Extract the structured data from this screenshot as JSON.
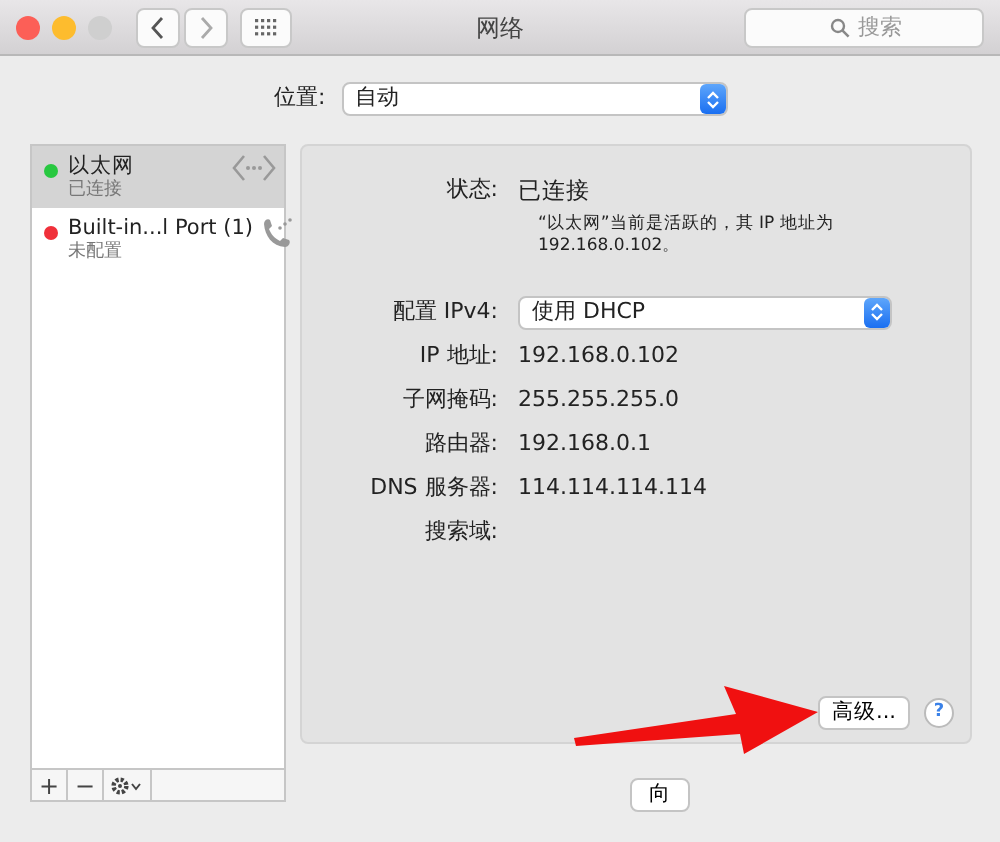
{
  "window": {
    "title": "网络",
    "search": {
      "placeholder": "搜索"
    }
  },
  "location": {
    "label": "位置:",
    "value": "自动"
  },
  "services": [
    {
      "name": "以太网",
      "status": "已连接",
      "color": "#28c840",
      "selected": true,
      "kind": "ethernet"
    },
    {
      "name": "Built-in...l Port (1)",
      "status": "未配置",
      "color": "#f0303a",
      "selected": false,
      "kind": "phone"
    }
  ],
  "sidebar_toolbar": [
    "+",
    "−"
  ],
  "details": {
    "status": {
      "label": "状态:",
      "value": "已连接",
      "description": "“以太网”当前是活跃的，其 IP 地址为 192.168.0.102。"
    },
    "configure": {
      "label": "配置 IPv4:",
      "value": "使用 DHCP"
    },
    "fields": [
      {
        "label": "IP 地址:",
        "value": "192.168.0.102"
      },
      {
        "label": "子网掩码:",
        "value": "255.255.255.0"
      },
      {
        "label": "路由器:",
        "value": "192.168.0.1"
      },
      {
        "label": "DNS 服务器:",
        "value": "114.114.114.114"
      },
      {
        "label": "搜索域:"
      }
    ],
    "advanced_button": "高级...",
    "help_button": "?"
  },
  "bottom_buttons": [
    "向"
  ]
}
